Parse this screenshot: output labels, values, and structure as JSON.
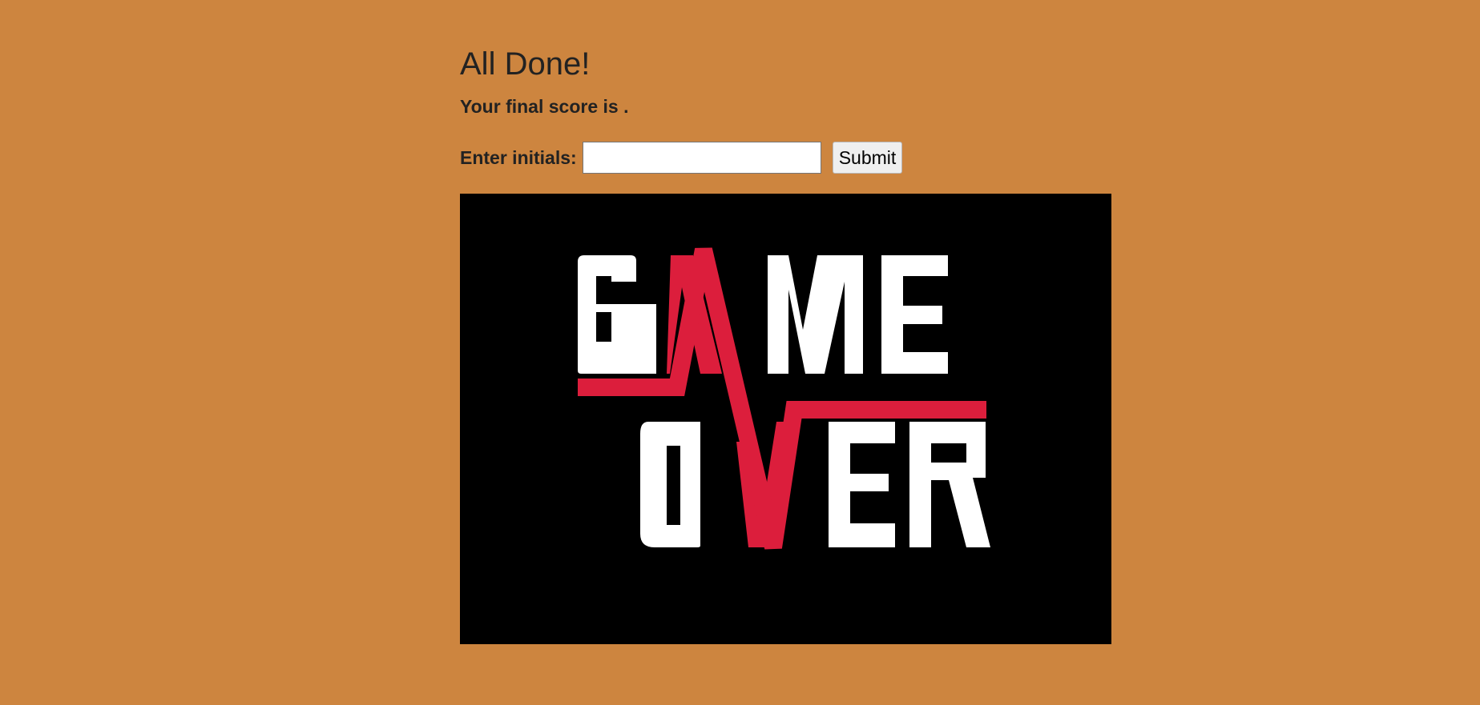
{
  "header": {
    "title": "All Done!"
  },
  "score": {
    "text": "Your final score is ."
  },
  "form": {
    "label": "Enter initials:",
    "input_value": "",
    "submit_label": "Submit"
  },
  "image": {
    "alt": "GAME OVER",
    "logo_text": "GAME OVER"
  },
  "colors": {
    "background": "#CD853F",
    "text": "#222222",
    "image_background": "#000000",
    "logo_white": "#FFFFFF",
    "logo_red": "#DC1E3C"
  }
}
